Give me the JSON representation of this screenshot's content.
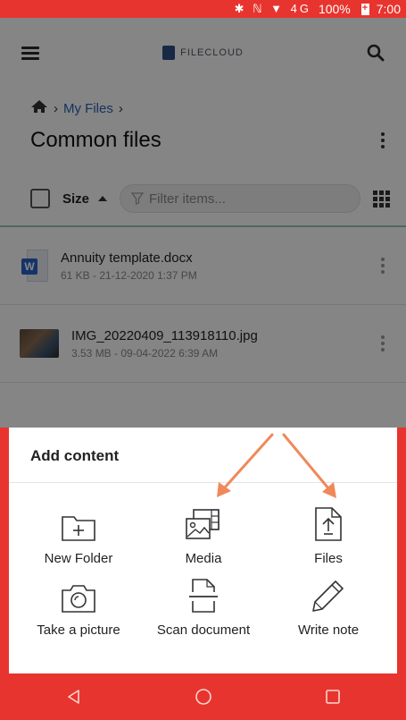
{
  "status": {
    "battery": "100%",
    "time": "7:00",
    "icons": "✱ ℕ ▼ 4G"
  },
  "app": {
    "logo_text": "FILECLOUD"
  },
  "breadcrumb": {
    "current": "My Files"
  },
  "page_title": "Common files",
  "filter_bar": {
    "sort_label": "Size",
    "filter_placeholder": "Filter items..."
  },
  "files": [
    {
      "name": "Annuity template.docx",
      "meta": "61 KB - 21-12-2020 1:37 PM",
      "type": "word"
    },
    {
      "name": "IMG_20220409_113918110.jpg",
      "meta": "3.53 MB - 09-04-2022 6:39 AM",
      "type": "image"
    }
  ],
  "sheet": {
    "title": "Add content",
    "actions": [
      {
        "label": "New Folder",
        "icon": "folder-plus-icon"
      },
      {
        "label": "Media",
        "icon": "media-icon"
      },
      {
        "label": "Files",
        "icon": "file-upload-icon"
      },
      {
        "label": "Take a picture",
        "icon": "camera-icon"
      },
      {
        "label": "Scan document",
        "icon": "scan-icon"
      },
      {
        "label": "Write note",
        "icon": "pencil-icon"
      }
    ]
  },
  "colors": {
    "status_bar": "#e8342e",
    "nav_bar": "#e8342e",
    "arrow": "#f0885a",
    "link": "#2a62b3"
  }
}
